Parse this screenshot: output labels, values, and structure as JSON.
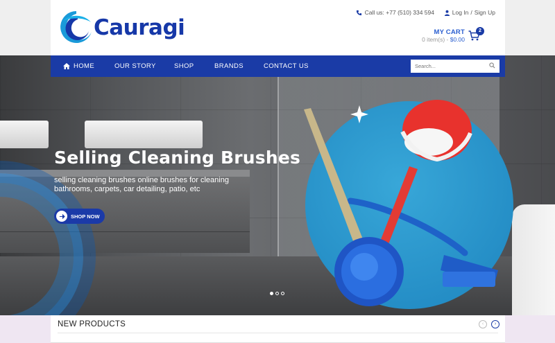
{
  "brand": {
    "name": "Cauragi",
    "color": "#1638a8"
  },
  "topbar": {
    "call_label": "Call us: +77 (510) 334 594",
    "login_label": "Log In",
    "separator": "/",
    "signup_label": "Sign Up"
  },
  "cart": {
    "title": "MY CART",
    "items_text": "0 item(s) - ",
    "amount": "$0.00",
    "count": "2"
  },
  "nav": {
    "items": [
      {
        "label": "HOME"
      },
      {
        "label": "OUR STORY"
      },
      {
        "label": "SHOP"
      },
      {
        "label": "BRANDS"
      },
      {
        "label": "CONTACT US"
      }
    ],
    "search_placeholder": "Search..."
  },
  "hero": {
    "title": "Selling Cleaning Brushes",
    "description": "selling cleaning brushes online brushes for cleaning bathrooms, carpets, car detailing, patio, etc",
    "button_label": "SHOP NOW",
    "slides": 3,
    "active_slide": 1
  },
  "products": {
    "section_title": "NEW PRODUCTS",
    "prev_label": "‹",
    "next_label": "›"
  },
  "colors": {
    "nav": "#1a3ba6",
    "accent": "#2b5fd0",
    "hero_circle": "#2a95cc"
  }
}
